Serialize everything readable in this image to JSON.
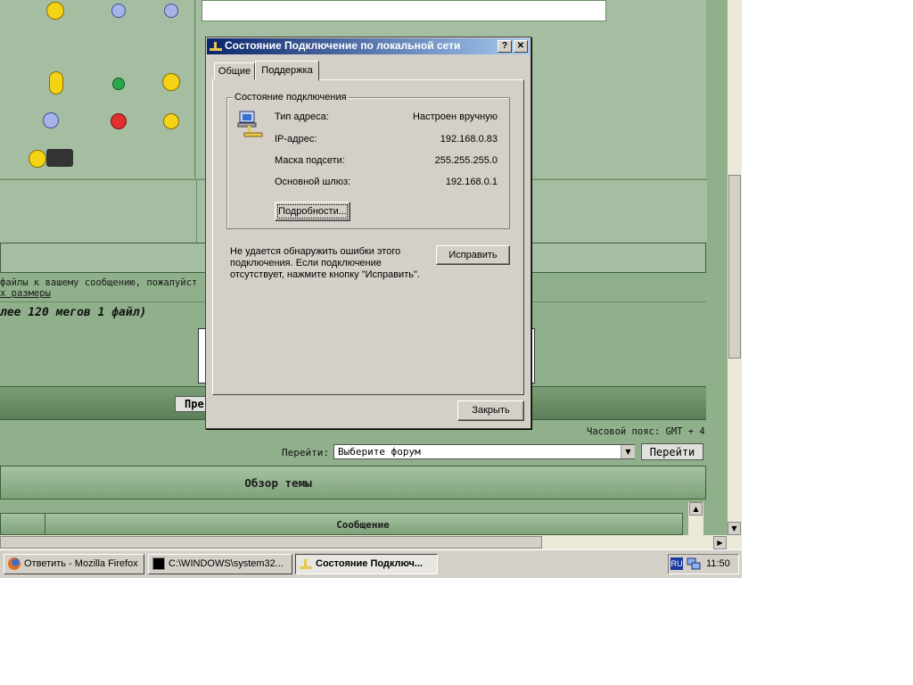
{
  "browser_page": {
    "attach_text": "файлы к вашему сообщению, пожалуйст",
    "attach_link": "х размеры",
    "size_text": "лее 120 мегов 1 файл)",
    "preview_button": "Пре",
    "timezone": "Часовой пояс: GMT + 4",
    "goto_label": "Перейти:",
    "goto_select_value": "Выберите форум",
    "goto_button": "Перейти",
    "topic_overview": "Обзор темы",
    "message_column": "Сообщение"
  },
  "dialog": {
    "title": "Состояние Подключение по локальной сети",
    "help_button": "?",
    "close_x": "✕",
    "tabs": [
      {
        "label": "Общие",
        "active": false
      },
      {
        "label": "Поддержка",
        "active": true
      }
    ],
    "group_title": "Состояние подключения",
    "fields": [
      {
        "label": "Тип адреса:",
        "value": "Настроен вручную"
      },
      {
        "label": "IP-адрес:",
        "value": "192.168.0.83"
      },
      {
        "label": "Маска подсети:",
        "value": "255.255.255.0"
      },
      {
        "label": "Основной шлюз:",
        "value": "192.168.0.1"
      }
    ],
    "details_button": "Подробности...",
    "repair_text": "Не удается обнаружить ошибки этого подключения. Если подключение отсутствует, нажмите кнопку \"Исправить\".",
    "repair_button": "Исправить",
    "close_button": "Закрыть"
  },
  "taskbar": {
    "tasks": [
      {
        "label": "Ответить - Mozilla Firefox",
        "icon": "firefox-icon",
        "active": false
      },
      {
        "label": "C:\\WINDOWS\\system32...",
        "icon": "console-icon",
        "active": false
      },
      {
        "label": "Состояние Подключ...",
        "icon": "network-icon",
        "active": true
      }
    ],
    "language": "RU",
    "clock": "11:50"
  },
  "colors": {
    "page_green": "#8fb08a",
    "title_bar_start": "#0a246a",
    "title_bar_end": "#a6caf0",
    "window_face": "#d4d0c8"
  }
}
